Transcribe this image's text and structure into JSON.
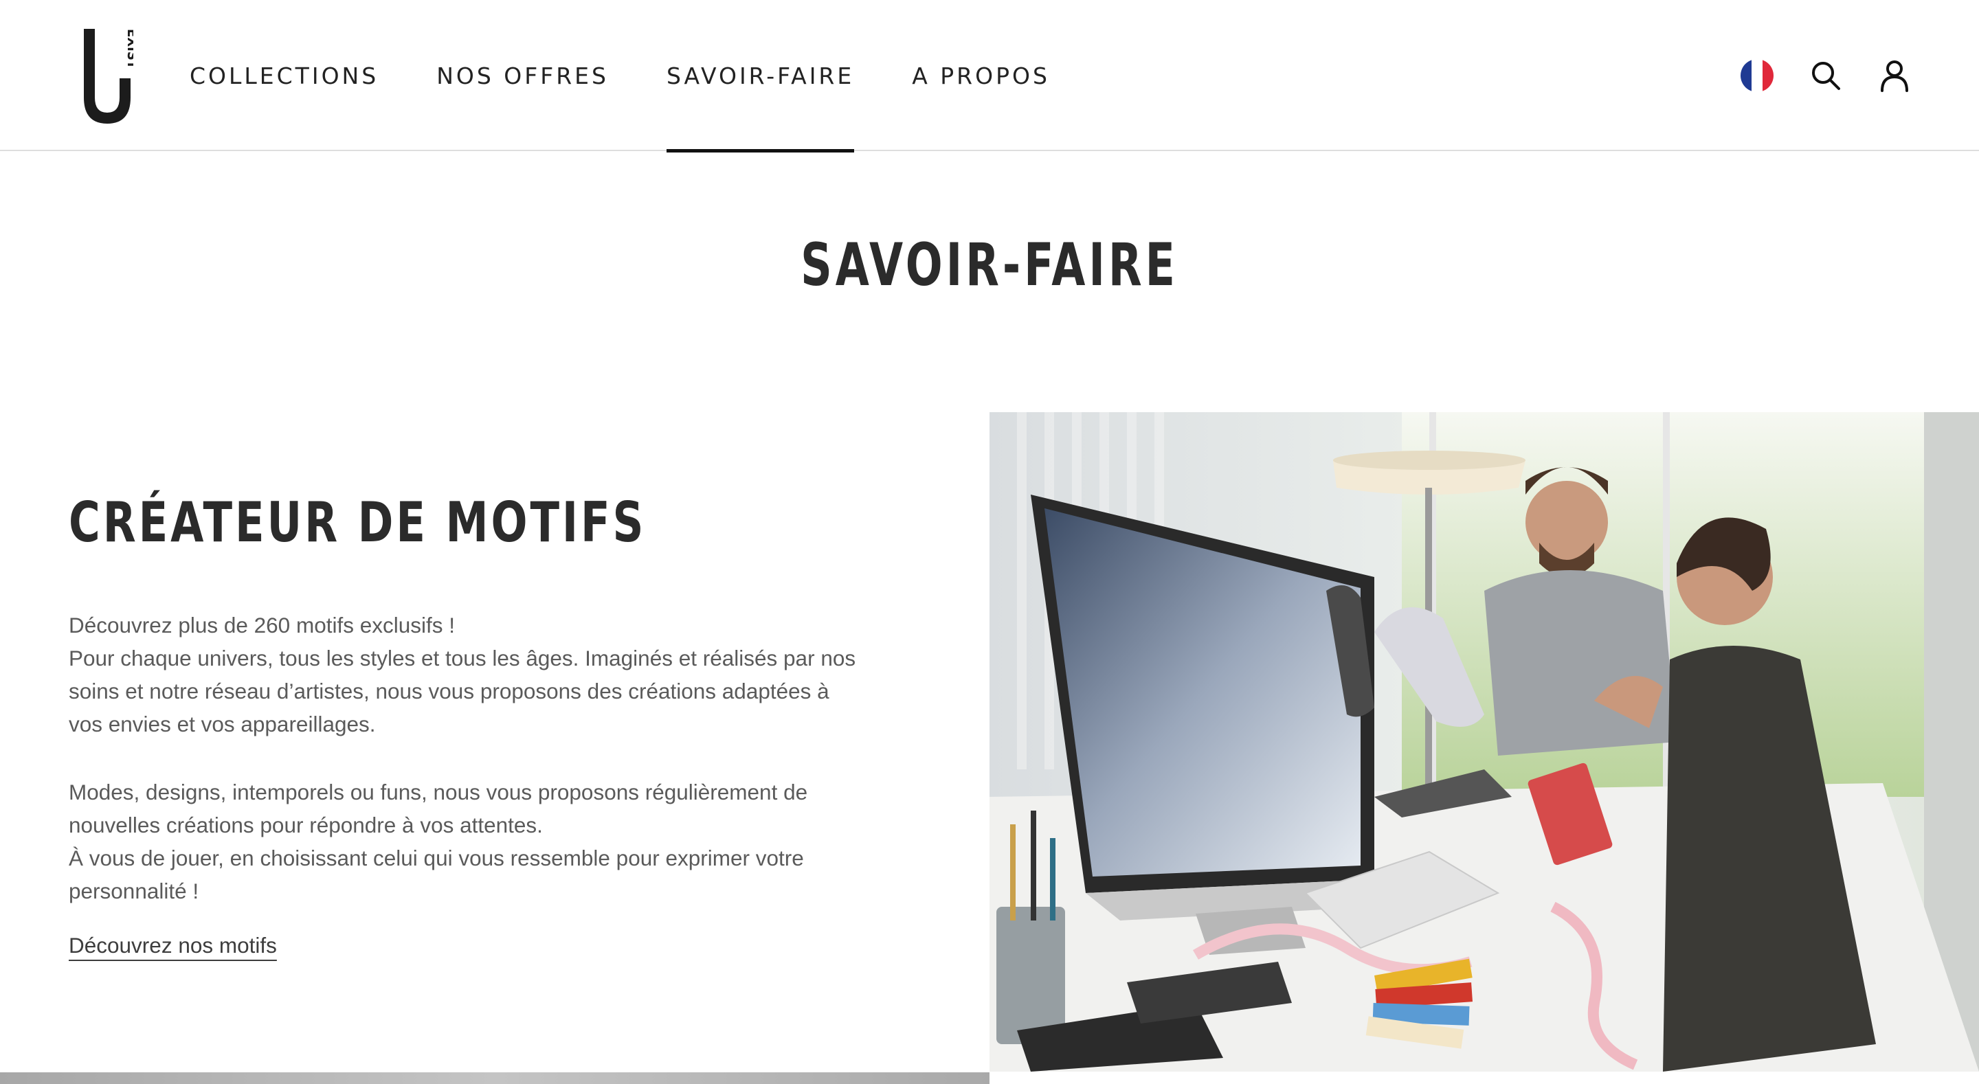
{
  "brand": {
    "logo_letter": "U",
    "logo_word": "EXIST"
  },
  "nav": {
    "items": [
      {
        "label": "COLLECTIONS"
      },
      {
        "label": "NOS OFFRES"
      },
      {
        "label": "SAVOIR-FAIRE",
        "active": true
      },
      {
        "label": "A PROPOS"
      }
    ]
  },
  "header_icons": {
    "language": "flag-fr-icon",
    "search": "search-icon",
    "account": "user-icon"
  },
  "page": {
    "title": "SAVOIR-FAIRE"
  },
  "section": {
    "heading": "CRÉATEUR DE MOTIFS",
    "paragraph1": [
      "Découvrez plus de 260 motifs exclusifs !",
      "Pour chaque univers, tous les styles et tous les âges. Imaginés et réalisés par nos soins et notre réseau d’artistes, nous vous proposons des créations adaptées à vos envies et vos appareillages."
    ],
    "paragraph2": [
      "Modes, designs, intemporels ou funs, nous vous proposons régulièrement de nouvelles créations pour répondre à vos attentes.",
      "À vous de jouer, en choisissant celui qui vous ressemble pour exprimer votre personnalité !"
    ],
    "link_label": "Découvrez nos motifs"
  },
  "colors": {
    "text_dark": "#2b2b2b",
    "text_body": "#5a5a5a",
    "border": "#dedede",
    "flag_blue": "#1f3a93",
    "flag_red": "#e0283a"
  }
}
